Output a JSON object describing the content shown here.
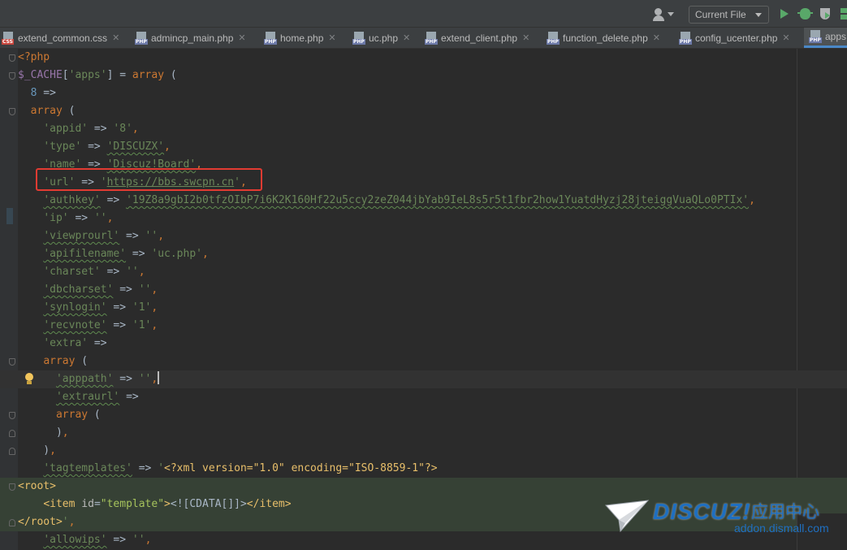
{
  "toolbar": {
    "run_config": "Current File",
    "icons": [
      "user-icon",
      "run-icon",
      "debug-icon",
      "coverage-icon"
    ]
  },
  "tabs": [
    {
      "type": "CSS",
      "label": "extend_common.css",
      "active": false
    },
    {
      "type": "PHP",
      "label": "admincp_main.php",
      "active": false
    },
    {
      "type": "PHP",
      "label": "home.php",
      "active": false
    },
    {
      "type": "PHP",
      "label": "uc.php",
      "active": false
    },
    {
      "type": "PHP",
      "label": "extend_client.php",
      "active": false
    },
    {
      "type": "PHP",
      "label": "function_delete.php",
      "active": false
    },
    {
      "type": "PHP",
      "label": "config_ucenter.php",
      "active": false
    },
    {
      "type": "PHP",
      "label": "apps",
      "active": true
    }
  ],
  "code": {
    "l1": "<?php",
    "l2_var": "$_CACHE",
    "l2_key": "'apps'",
    "l2_kw": "array",
    "l3_num": "8",
    "l4_kw": "array",
    "appid_key": "'appid'",
    "appid_val": "'8'",
    "type_key": "'type'",
    "type_val": "'DISCUZX'",
    "name_key": "'name'",
    "name_val": "'Discuz!Board'",
    "url_key": "'url'",
    "url_val": "https://bbs.swcpn.cn",
    "authkey_key": "'authkey'",
    "authkey_val": "'19Z8a9gbI2b0tfzOIbP7i6K2K160Hf22u5ccy2zeZ044jbYab9IeL8s5r5t1fbr2how1YuatdHyzj28jteiggVuaQLo0PTIx'",
    "ip_key": "'ip'",
    "ip_val": "''",
    "viewprourl_key": "'viewprourl'",
    "viewprourl_val": "''",
    "apifilename_key": "'apifilename'",
    "apifilename_val": "'uc.php'",
    "charset_key": "'charset'",
    "charset_val": "''",
    "dbcharset_key": "'dbcharset'",
    "dbcharset_val": "''",
    "synlogin_key": "'synlogin'",
    "synlogin_val": "'1'",
    "recvnote_key": "'recvnote'",
    "recvnote_val": "'1'",
    "extra_key": "'extra'",
    "extra_kw": "array",
    "apppath_key": "'apppath'",
    "apppath_val": "''",
    "extraurl_key": "'extraurl'",
    "extraurl_kw": "array",
    "tagtemplates_key": "'tagtemplates'",
    "xml_decl": "<?xml version=\"1.0\" encoding=\"ISO-8859-1\"?>",
    "root_open": "<root>",
    "item_open": "<item",
    "item_attr": "id",
    "item_attr_val": "\"template\"",
    "cdata": "<![CDATA[]]>",
    "item_close": "</item>",
    "root_close": "</root>",
    "allowips_key": "'allowips'",
    "allowips_val": "''"
  },
  "watermark": {
    "brand": "DISCUZ!",
    "subtitle": "应用中心",
    "url": "addon.dismall.com"
  }
}
